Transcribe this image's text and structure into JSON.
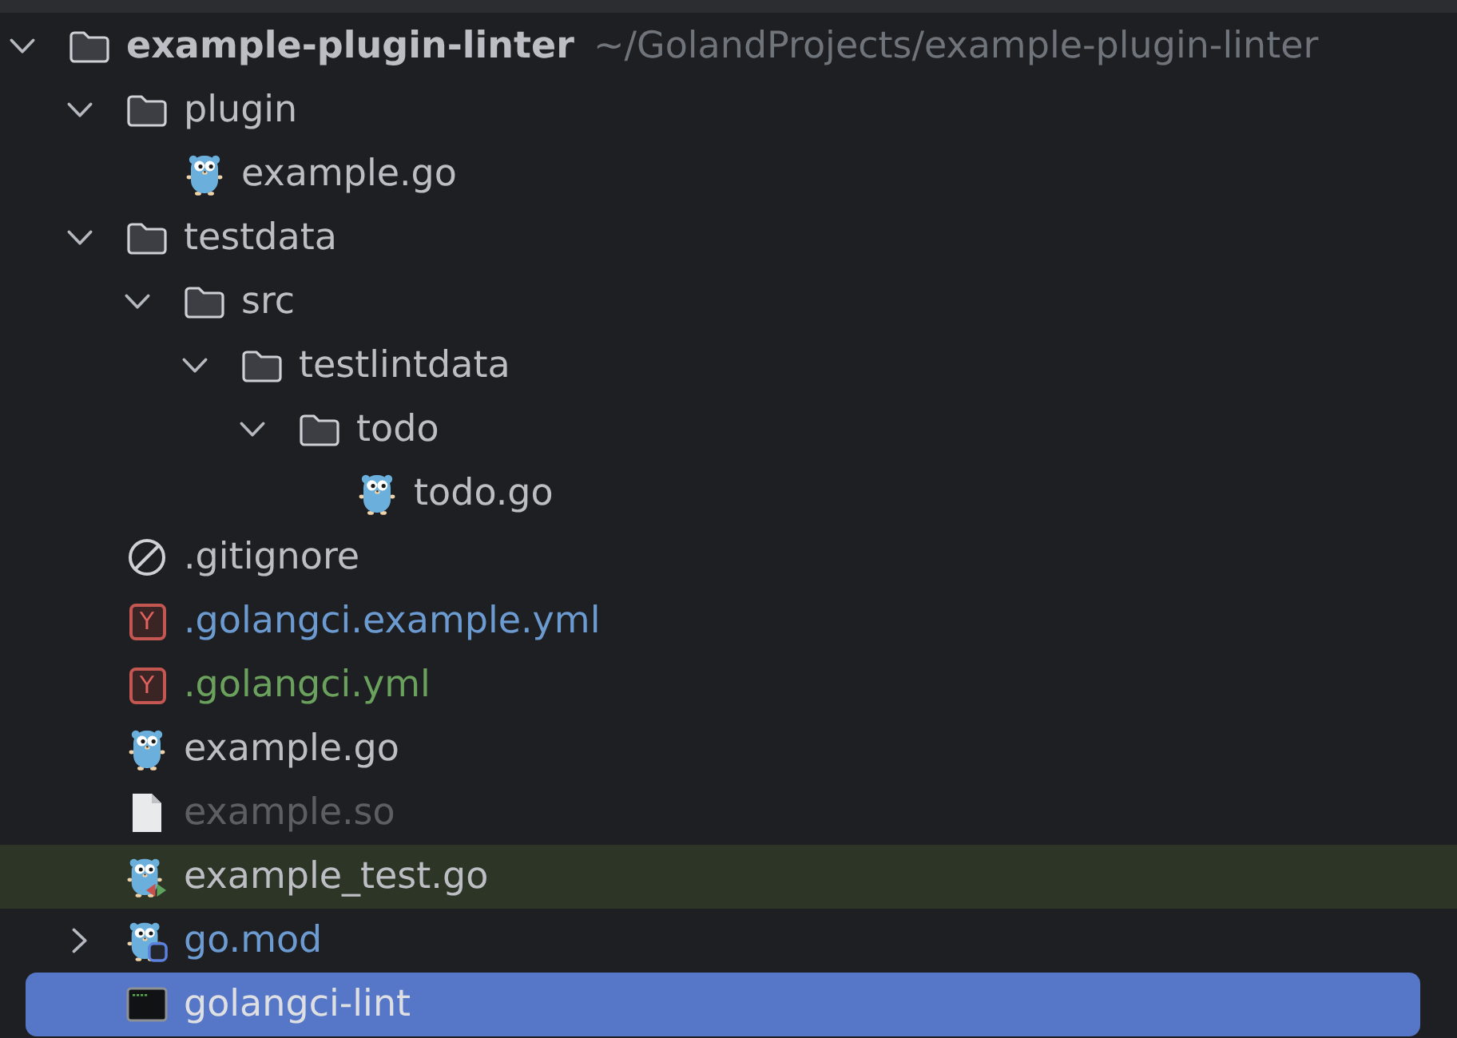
{
  "project_tree": {
    "items": [
      {
        "kind": "folder",
        "name": "example-plugin-linter",
        "path": "~/GolandProjects/example-plugin-linter",
        "expanded": true,
        "selected": false,
        "highlighted": false,
        "modified": false,
        "added": false,
        "ignored": false,
        "children": [
          {
            "kind": "folder",
            "name": "plugin",
            "expanded": true,
            "selected": false,
            "highlighted": false,
            "modified": false,
            "added": false,
            "ignored": false,
            "children": [
              {
                "kind": "go",
                "name": "example.go",
                "selected": false,
                "highlighted": false,
                "modified": false,
                "added": false,
                "ignored": false
              }
            ]
          },
          {
            "kind": "folder",
            "name": "testdata",
            "expanded": true,
            "selected": false,
            "highlighted": false,
            "modified": false,
            "added": false,
            "ignored": false,
            "children": [
              {
                "kind": "folder",
                "name": "src",
                "expanded": true,
                "selected": false,
                "highlighted": false,
                "modified": false,
                "added": false,
                "ignored": false,
                "children": [
                  {
                    "kind": "folder",
                    "name": "testlintdata",
                    "expanded": true,
                    "selected": false,
                    "highlighted": false,
                    "modified": false,
                    "added": false,
                    "ignored": false,
                    "children": [
                      {
                        "kind": "folder",
                        "name": "todo",
                        "expanded": true,
                        "selected": false,
                        "highlighted": false,
                        "modified": false,
                        "added": false,
                        "ignored": false,
                        "children": [
                          {
                            "kind": "go",
                            "name": "todo.go",
                            "selected": false,
                            "highlighted": false,
                            "modified": false,
                            "added": false,
                            "ignored": false
                          }
                        ]
                      }
                    ]
                  }
                ]
              }
            ]
          },
          {
            "kind": "gitignore",
            "name": ".gitignore",
            "selected": false,
            "highlighted": false,
            "modified": false,
            "added": false,
            "ignored": false
          },
          {
            "kind": "yaml",
            "badge": "Y",
            "name": ".golangci.example.yml",
            "selected": false,
            "highlighted": false,
            "modified": true,
            "added": false,
            "ignored": false
          },
          {
            "kind": "yaml",
            "badge": "Y",
            "name": ".golangci.yml",
            "selected": false,
            "highlighted": false,
            "modified": false,
            "added": true,
            "ignored": false
          },
          {
            "kind": "go",
            "name": "example.go",
            "selected": false,
            "highlighted": false,
            "modified": false,
            "added": false,
            "ignored": false
          },
          {
            "kind": "file",
            "name": "example.so",
            "selected": false,
            "highlighted": false,
            "modified": false,
            "added": false,
            "ignored": true
          },
          {
            "kind": "go_test",
            "name": "example_test.go",
            "selected": false,
            "highlighted": true,
            "modified": false,
            "added": false,
            "ignored": false
          },
          {
            "kind": "go_mod",
            "name": "go.mod",
            "expanded": false,
            "selected": false,
            "highlighted": false,
            "modified": true,
            "added": false,
            "ignored": false
          },
          {
            "kind": "executable",
            "name": "golangci-lint",
            "selected": true,
            "highlighted": false,
            "modified": false,
            "added": false,
            "ignored": false
          }
        ]
      }
    ]
  }
}
